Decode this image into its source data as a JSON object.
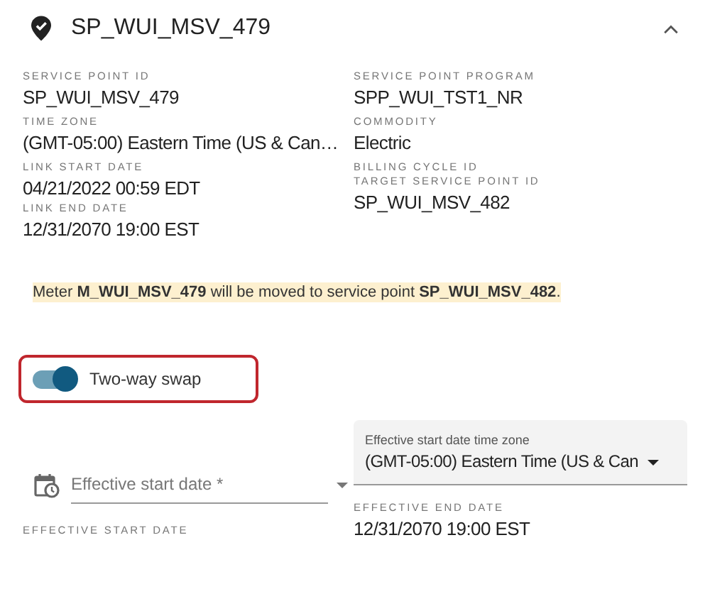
{
  "header": {
    "title": "SP_WUI_MSV_479",
    "expanded": true
  },
  "details_left": [
    {
      "label": "SERVICE POINT ID",
      "value": "SP_WUI_MSV_479"
    },
    {
      "label": "TIME ZONE",
      "value": "(GMT-05:00) Eastern Time (US & Can…"
    },
    {
      "label": "LINK START DATE",
      "value": "04/21/2022 00:59 EDT"
    },
    {
      "label": "LINK END DATE",
      "value": "12/31/2070 19:00 EST"
    }
  ],
  "details_right": [
    {
      "label": "SERVICE POINT PROGRAM",
      "value": "SPP_WUI_TST1_NR"
    },
    {
      "label": "COMMODITY",
      "value": "Electric"
    },
    {
      "label": "BILLING CYCLE ID"
    },
    {
      "label": "TARGET SERVICE POINT ID",
      "value": "SP_WUI_MSV_482"
    }
  ],
  "notice": "Meter **M_WUI_MSV_479** will be moved to service point **SP_WUI_MSV_482**.",
  "swap_toggle": {
    "label": "Two-way swap",
    "on": true
  },
  "start_date_field": {
    "placeholder": "Effective start date *"
  },
  "timezone_field": {
    "label": "Effective start date time zone",
    "value": "(GMT-05:00) Eastern Time (US & Can"
  },
  "effective_start": {
    "label": "EFFECTIVE START DATE"
  },
  "effective_end": {
    "label": "EFFECTIVE END DATE",
    "value": "12/31/2070 19:00 EST"
  }
}
